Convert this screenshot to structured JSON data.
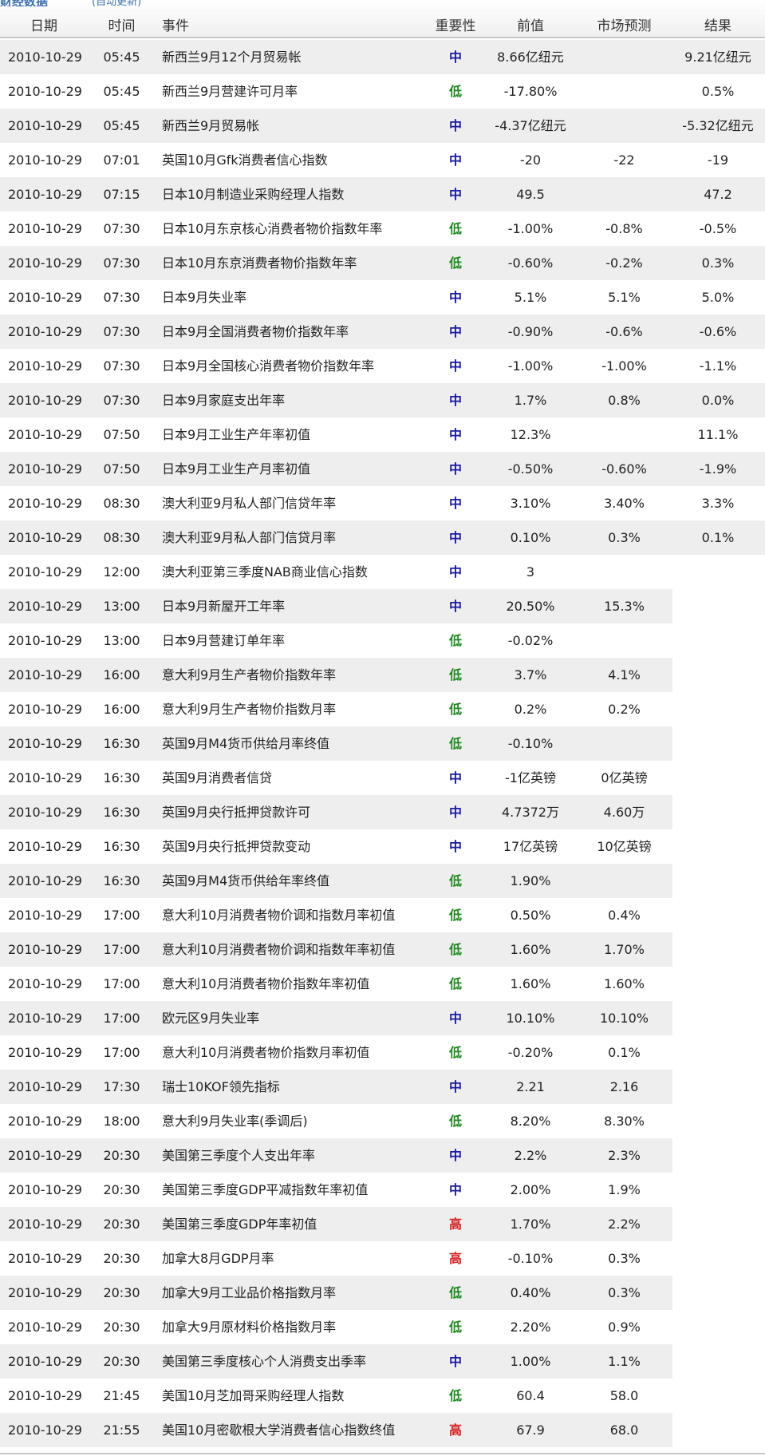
{
  "partial_header": {
    "title_fragment": "财经数据",
    "link_fragment": "(自动更新)"
  },
  "columns": {
    "date": "日期",
    "time": "时间",
    "event": "事件",
    "importance": "重要性",
    "previous": "前值",
    "forecast": "市场预测",
    "result": "结果"
  },
  "colors": {
    "中": "#1a1aa6",
    "低": "#1e8a1e",
    "高": "#d61d1d",
    "row_alt_bg": "#eeeeee"
  },
  "rows": [
    {
      "date": "2010-10-29",
      "time": "05:45",
      "event": "新西兰9月12个月贸易帐",
      "importance": "中",
      "previous": "8.66亿纽元",
      "forecast": "",
      "result": "9.21亿纽元",
      "shade": "full"
    },
    {
      "date": "2010-10-29",
      "time": "05:45",
      "event": "新西兰9月营建许可月率",
      "importance": "低",
      "previous": "-17.80%",
      "forecast": "",
      "result": "0.5%",
      "shade": "none"
    },
    {
      "date": "2010-10-29",
      "time": "05:45",
      "event": "新西兰9月贸易帐",
      "importance": "中",
      "previous": "-4.37亿纽元",
      "forecast": "",
      "result": "-5.32亿纽元",
      "shade": "full"
    },
    {
      "date": "2010-10-29",
      "time": "07:01",
      "event": "英国10月Gfk消费者信心指数",
      "importance": "中",
      "previous": "-20",
      "forecast": "-22",
      "result": "-19",
      "shade": "none"
    },
    {
      "date": "2010-10-29",
      "time": "07:15",
      "event": "日本10月制造业采购经理人指数",
      "importance": "中",
      "previous": "49.5",
      "forecast": "",
      "result": "47.2",
      "shade": "full"
    },
    {
      "date": "2010-10-29",
      "time": "07:30",
      "event": "日本10月东京核心消费者物价指数年率",
      "importance": "低",
      "previous": "-1.00%",
      "forecast": "-0.8%",
      "result": "-0.5%",
      "shade": "none"
    },
    {
      "date": "2010-10-29",
      "time": "07:30",
      "event": "日本10月东京消费者物价指数年率",
      "importance": "低",
      "previous": "-0.60%",
      "forecast": "-0.2%",
      "result": "0.3%",
      "shade": "full"
    },
    {
      "date": "2010-10-29",
      "time": "07:30",
      "event": "日本9月失业率",
      "importance": "中",
      "previous": "5.1%",
      "forecast": "5.1%",
      "result": "5.0%",
      "shade": "none"
    },
    {
      "date": "2010-10-29",
      "time": "07:30",
      "event": "日本9月全国消费者物价指数年率",
      "importance": "中",
      "previous": "-0.90%",
      "forecast": "-0.6%",
      "result": "-0.6%",
      "shade": "full"
    },
    {
      "date": "2010-10-29",
      "time": "07:30",
      "event": "日本9月全国核心消费者物价指数年率",
      "importance": "中",
      "previous": "-1.00%",
      "forecast": "-1.00%",
      "result": "-1.1%",
      "shade": "none"
    },
    {
      "date": "2010-10-29",
      "time": "07:30",
      "event": "日本9月家庭支出年率",
      "importance": "中",
      "previous": "1.7%",
      "forecast": "0.8%",
      "result": "0.0%",
      "shade": "full"
    },
    {
      "date": "2010-10-29",
      "time": "07:50",
      "event": "日本9月工业生产年率初值",
      "importance": "中",
      "previous": "12.3%",
      "forecast": "",
      "result": "11.1%",
      "shade": "none"
    },
    {
      "date": "2010-10-29",
      "time": "07:50",
      "event": "日本9月工业生产月率初值",
      "importance": "中",
      "previous": "-0.50%",
      "forecast": "-0.60%",
      "result": "-1.9%",
      "shade": "full"
    },
    {
      "date": "2010-10-29",
      "time": "08:30",
      "event": "澳大利亚9月私人部门信贷年率",
      "importance": "中",
      "previous": "3.10%",
      "forecast": "3.40%",
      "result": "3.3%",
      "shade": "none"
    },
    {
      "date": "2010-10-29",
      "time": "08:30",
      "event": "澳大利亚9月私人部门信贷月率",
      "importance": "中",
      "previous": "0.10%",
      "forecast": "0.3%",
      "result": "0.1%",
      "shade": "full"
    },
    {
      "date": "2010-10-29",
      "time": "12:00",
      "event": "澳大利亚第三季度NAB商业信心指数",
      "importance": "中",
      "previous": "3",
      "forecast": "",
      "result": "",
      "shade": "none"
    },
    {
      "date": "2010-10-29",
      "time": "13:00",
      "event": "日本9月新屋开工年率",
      "importance": "中",
      "previous": "20.50%",
      "forecast": "15.3%",
      "result": "",
      "shade": "partial"
    },
    {
      "date": "2010-10-29",
      "time": "13:00",
      "event": "日本9月营建订单年率",
      "importance": "低",
      "previous": "-0.02%",
      "forecast": "",
      "result": "",
      "shade": "none"
    },
    {
      "date": "2010-10-29",
      "time": "16:00",
      "event": "意大利9月生产者物价指数年率",
      "importance": "低",
      "previous": "3.7%",
      "forecast": "4.1%",
      "result": "",
      "shade": "partial"
    },
    {
      "date": "2010-10-29",
      "time": "16:00",
      "event": "意大利9月生产者物价指数月率",
      "importance": "低",
      "previous": "0.2%",
      "forecast": "0.2%",
      "result": "",
      "shade": "none"
    },
    {
      "date": "2010-10-29",
      "time": "16:30",
      "event": "英国9月M4货币供给月率终值",
      "importance": "低",
      "previous": "-0.10%",
      "forecast": "",
      "result": "",
      "shade": "partial"
    },
    {
      "date": "2010-10-29",
      "time": "16:30",
      "event": "英国9月消费者信贷",
      "importance": "中",
      "previous": "-1亿英镑",
      "forecast": "0亿英镑",
      "result": "",
      "shade": "none"
    },
    {
      "date": "2010-10-29",
      "time": "16:30",
      "event": "英国9月央行抵押贷款许可",
      "importance": "中",
      "previous": "4.7372万",
      "forecast": "4.60万",
      "result": "",
      "shade": "partial"
    },
    {
      "date": "2010-10-29",
      "time": "16:30",
      "event": "英国9月央行抵押贷款变动",
      "importance": "中",
      "previous": "17亿英镑",
      "forecast": "10亿英镑",
      "result": "",
      "shade": "none"
    },
    {
      "date": "2010-10-29",
      "time": "16:30",
      "event": "英国9月M4货币供给年率终值",
      "importance": "低",
      "previous": "1.90%",
      "forecast": "",
      "result": "",
      "shade": "partial"
    },
    {
      "date": "2010-10-29",
      "time": "17:00",
      "event": "意大利10月消费者物价调和指数月率初值",
      "importance": "低",
      "previous": "0.50%",
      "forecast": "0.4%",
      "result": "",
      "shade": "none"
    },
    {
      "date": "2010-10-29",
      "time": "17:00",
      "event": "意大利10月消费者物价调和指数年率初值",
      "importance": "低",
      "previous": "1.60%",
      "forecast": "1.70%",
      "result": "",
      "shade": "partial"
    },
    {
      "date": "2010-10-29",
      "time": "17:00",
      "event": "意大利10月消费者物价指数年率初值",
      "importance": "低",
      "previous": "1.60%",
      "forecast": "1.60%",
      "result": "",
      "shade": "none"
    },
    {
      "date": "2010-10-29",
      "time": "17:00",
      "event": "欧元区9月失业率",
      "importance": "中",
      "previous": "10.10%",
      "forecast": "10.10%",
      "result": "",
      "shade": "partial"
    },
    {
      "date": "2010-10-29",
      "time": "17:00",
      "event": "意大利10月消费者物价指数月率初值",
      "importance": "低",
      "previous": "-0.20%",
      "forecast": "0.1%",
      "result": "",
      "shade": "none"
    },
    {
      "date": "2010-10-29",
      "time": "17:30",
      "event": "瑞士10KOF领先指标",
      "importance": "中",
      "previous": "2.21",
      "forecast": "2.16",
      "result": "",
      "shade": "partial"
    },
    {
      "date": "2010-10-29",
      "time": "18:00",
      "event": "意大利9月失业率(季调后)",
      "importance": "低",
      "previous": "8.20%",
      "forecast": "8.30%",
      "result": "",
      "shade": "none"
    },
    {
      "date": "2010-10-29",
      "time": "20:30",
      "event": "美国第三季度个人支出年率",
      "importance": "中",
      "previous": "2.2%",
      "forecast": "2.3%",
      "result": "",
      "shade": "partial"
    },
    {
      "date": "2010-10-29",
      "time": "20:30",
      "event": "美国第三季度GDP平减指数年率初值",
      "importance": "中",
      "previous": "2.00%",
      "forecast": "1.9%",
      "result": "",
      "shade": "none"
    },
    {
      "date": "2010-10-29",
      "time": "20:30",
      "event": "美国第三季度GDP年率初值",
      "importance": "高",
      "previous": "1.70%",
      "forecast": "2.2%",
      "result": "",
      "shade": "partial"
    },
    {
      "date": "2010-10-29",
      "time": "20:30",
      "event": "加拿大8月GDP月率",
      "importance": "高",
      "previous": "-0.10%",
      "forecast": "0.3%",
      "result": "",
      "shade": "none"
    },
    {
      "date": "2010-10-29",
      "time": "20:30",
      "event": "加拿大9月工业品价格指数月率",
      "importance": "低",
      "previous": "0.40%",
      "forecast": "0.3%",
      "result": "",
      "shade": "partial"
    },
    {
      "date": "2010-10-29",
      "time": "20:30",
      "event": "加拿大9月原材料价格指数月率",
      "importance": "低",
      "previous": "2.20%",
      "forecast": "0.9%",
      "result": "",
      "shade": "none"
    },
    {
      "date": "2010-10-29",
      "time": "20:30",
      "event": "美国第三季度核心个人消费支出季率",
      "importance": "中",
      "previous": "1.00%",
      "forecast": "1.1%",
      "result": "",
      "shade": "partial"
    },
    {
      "date": "2010-10-29",
      "time": "21:45",
      "event": "美国10月芝加哥采购经理人指数",
      "importance": "低",
      "previous": "60.4",
      "forecast": "58.0",
      "result": "",
      "shade": "none"
    },
    {
      "date": "2010-10-29",
      "time": "21:55",
      "event": "美国10月密歇根大学消费者信心指数终值",
      "importance": "高",
      "previous": "67.9",
      "forecast": "68.0",
      "result": "",
      "shade": "partial"
    }
  ]
}
